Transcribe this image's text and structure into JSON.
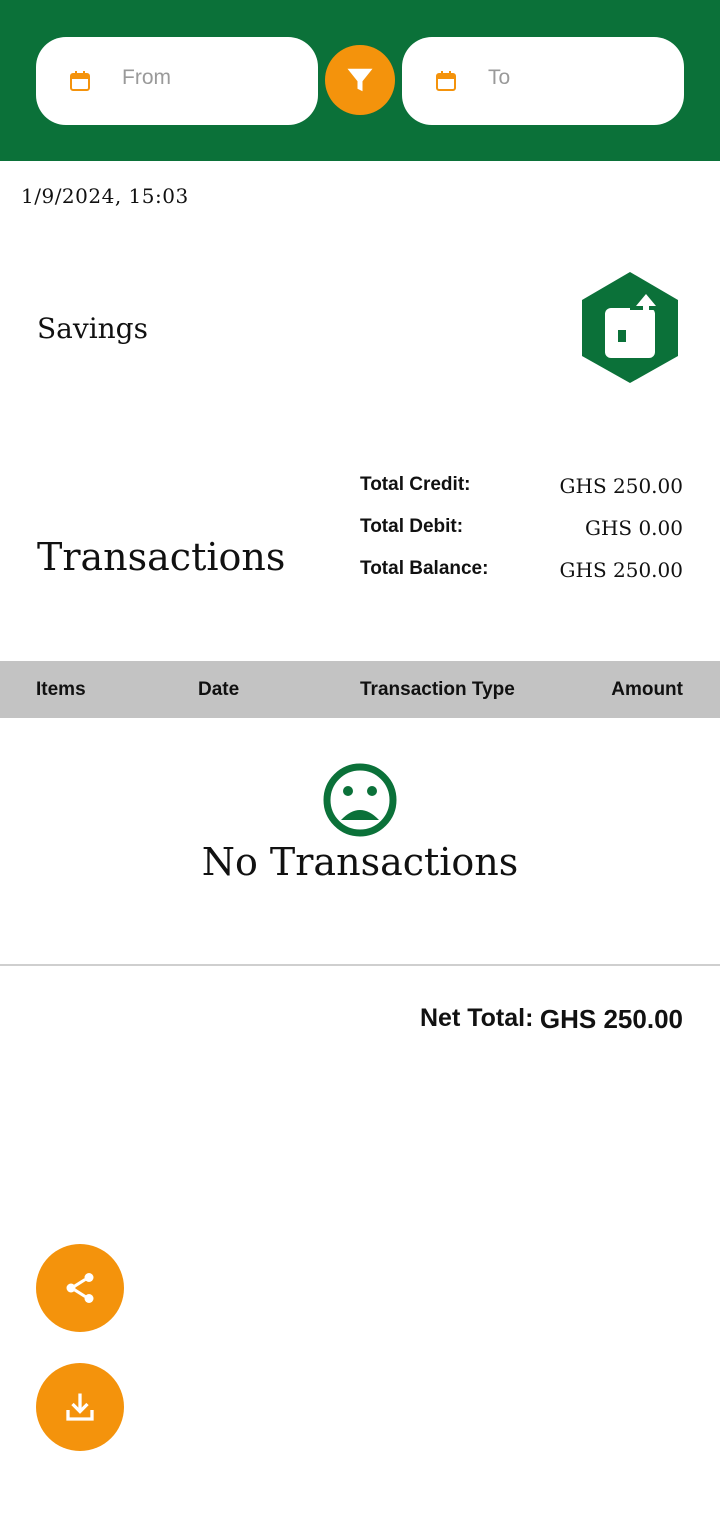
{
  "filters": {
    "from_placeholder": "From",
    "to_placeholder": "To"
  },
  "timestamp": "1/9/2024, 15:03",
  "account": {
    "name": "Savings"
  },
  "transactions": {
    "title": "Transactions",
    "summary": {
      "credit_label": "Total Credit:",
      "credit_value": "GHS 250.00",
      "debit_label": "Total Debit:",
      "debit_value": "GHS 0.00",
      "balance_label": "Total Balance:",
      "balance_value": "GHS 250.00"
    },
    "columns": [
      "Items",
      "Date",
      "Transaction Type",
      "Amount"
    ],
    "empty_text": "No Transactions"
  },
  "net_total": {
    "label": "Net Total:",
    "value": "GHS 250.00"
  },
  "icons": {
    "calendar": "calendar-icon",
    "filter": "filter-icon",
    "account": "wallet-unlock-icon",
    "empty": "sad-face-icon",
    "share": "share-icon",
    "download": "download-icon"
  },
  "colors": {
    "primary_green": "#0b7139",
    "accent_orange": "#f4930c",
    "table_header_gray": "#c3c3c3"
  }
}
